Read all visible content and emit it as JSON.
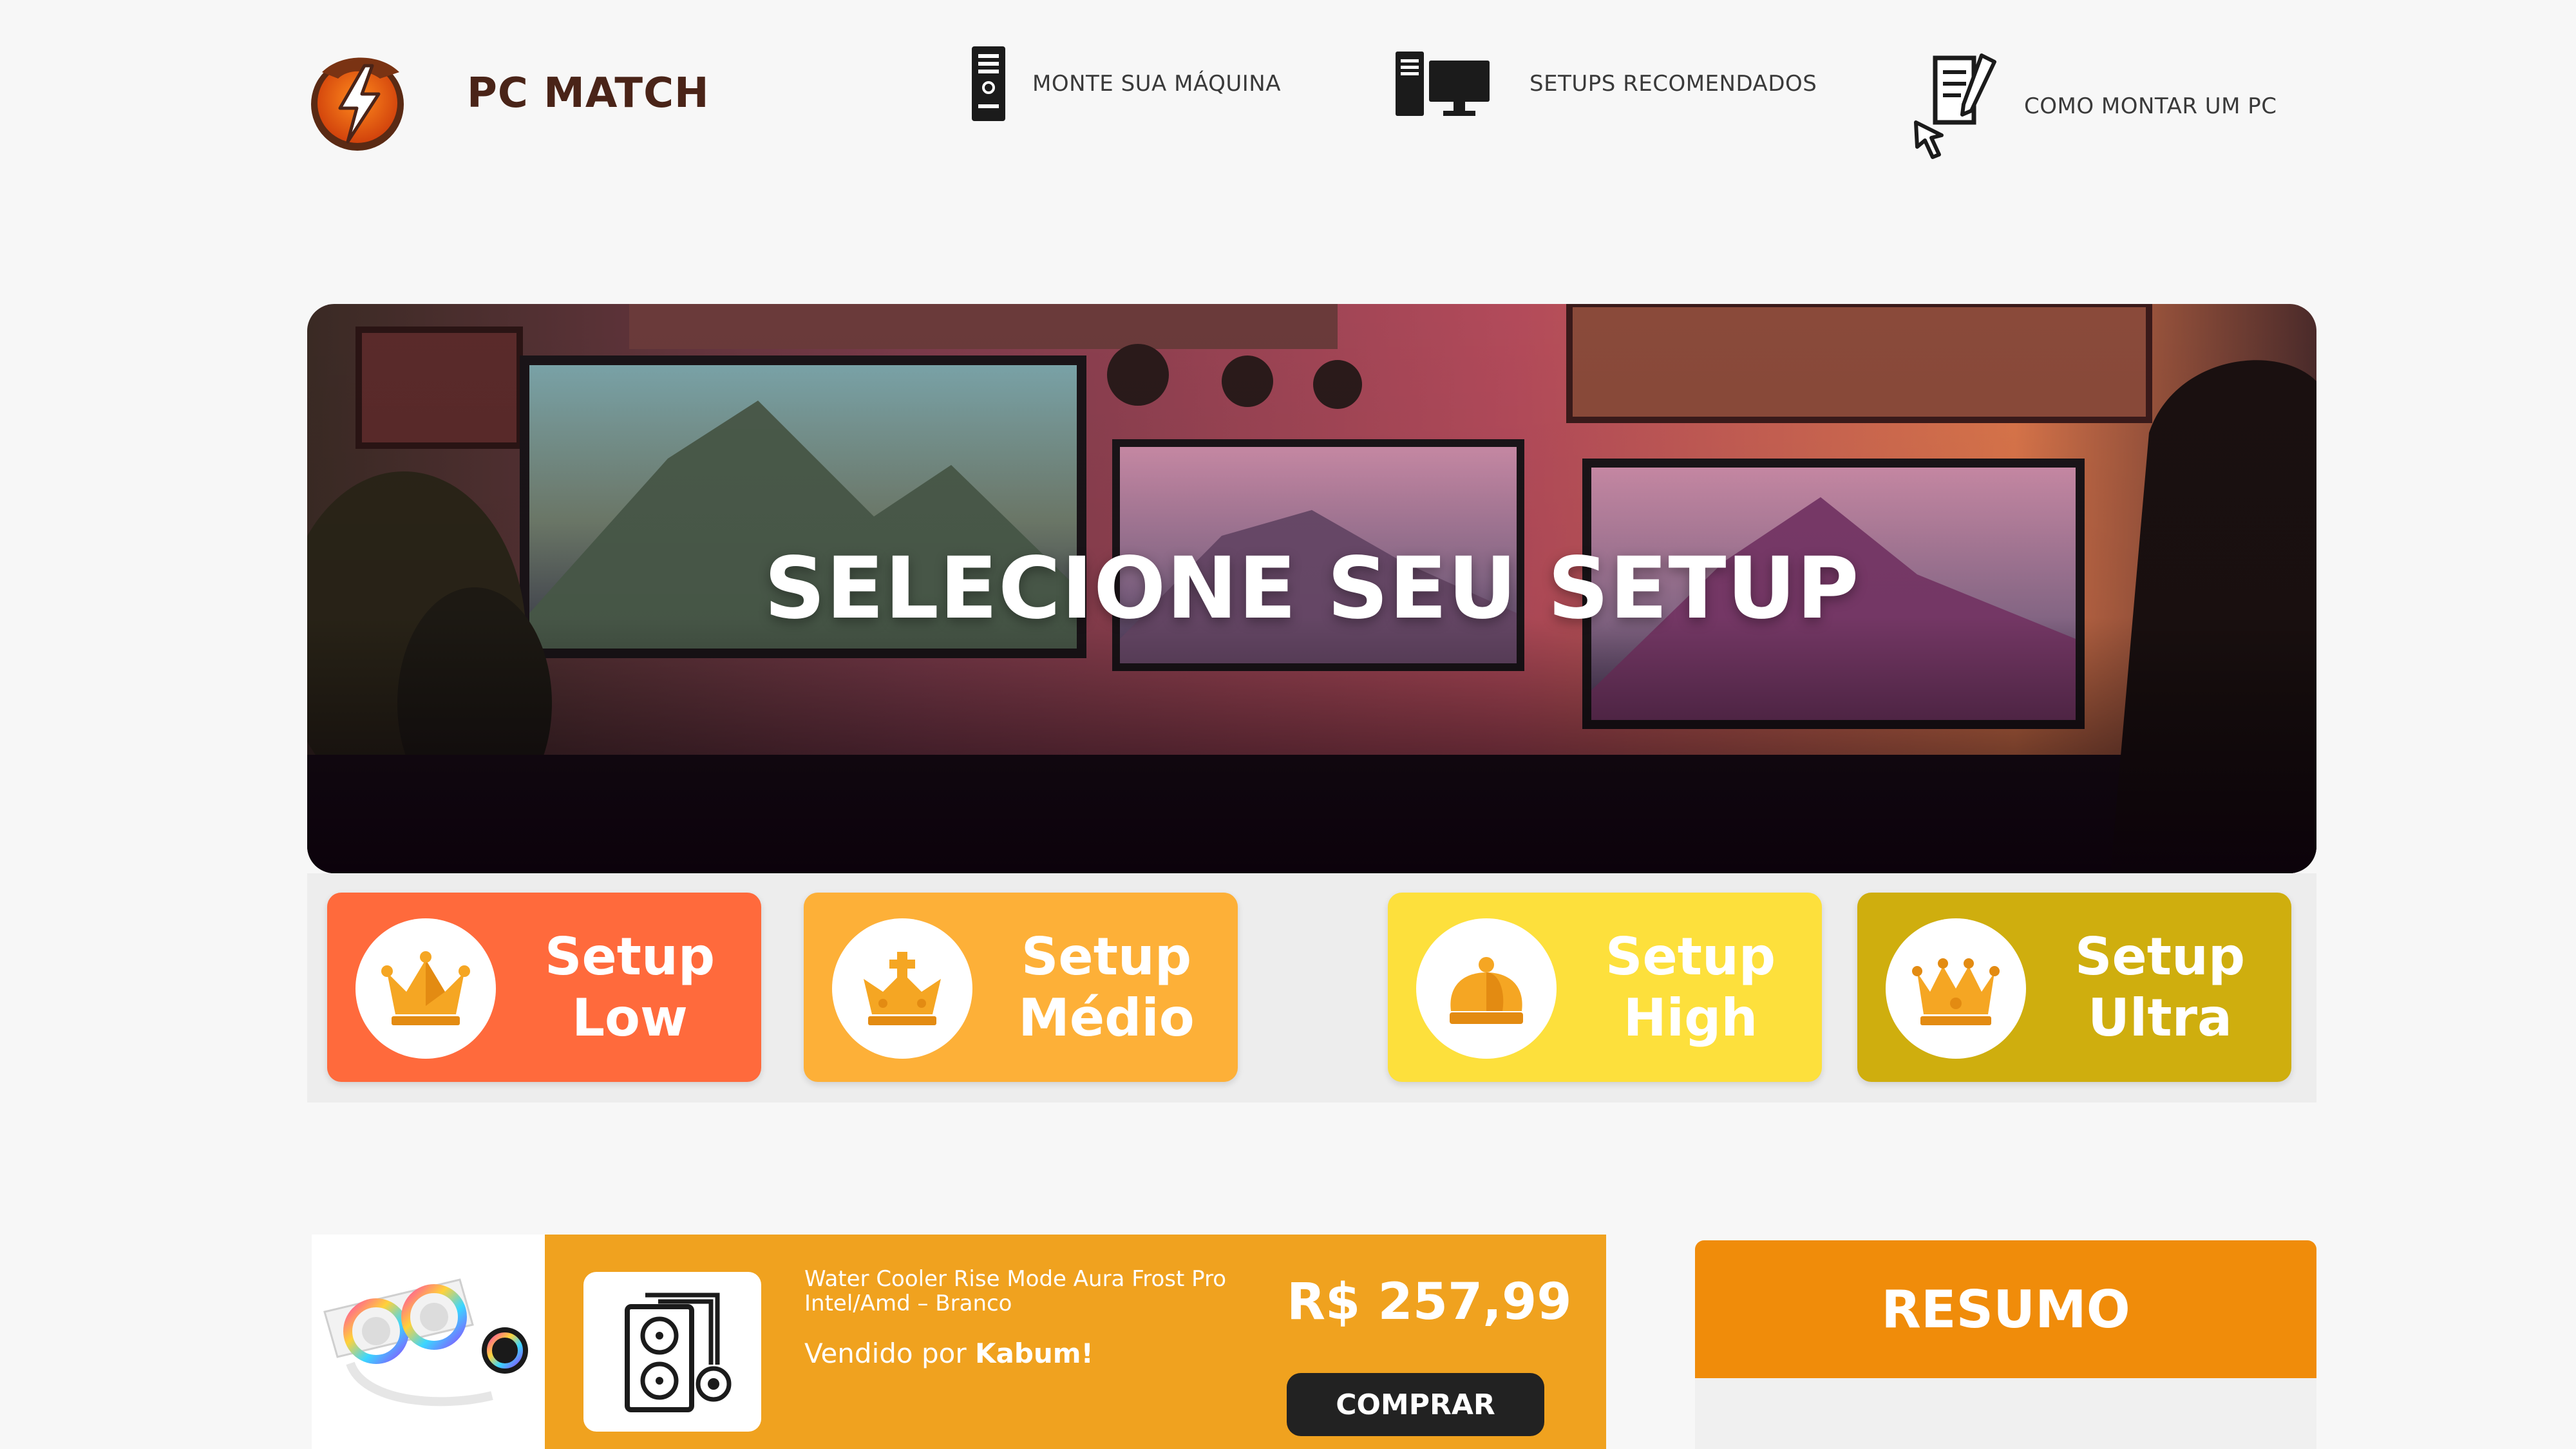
{
  "brand": {
    "name": "PC MATCH"
  },
  "nav": [
    {
      "label": "MONTE SUA MÁQUINA",
      "icon": "pc-tower-icon"
    },
    {
      "label": "SETUPS RECOMENDADOS",
      "icon": "desktop-setup-icon"
    },
    {
      "label": "COMO MONTAR UM PC",
      "icon": "document-pen-icon"
    }
  ],
  "hero": {
    "title": "SELECIONE SEU SETUP"
  },
  "setups": [
    {
      "label_line1": "Setup",
      "label_line2": "Low",
      "color": "#ff6a3c"
    },
    {
      "label_line1": "Setup",
      "label_line2": "Médio",
      "color": "#fdb038"
    },
    {
      "label_line1": "Setup",
      "label_line2": "High",
      "color": "#fde03c"
    },
    {
      "label_line1": "Setup",
      "label_line2": "Ultra",
      "color": "#cfae0e"
    }
  ],
  "product": {
    "name": "Water Cooler Rise Mode Aura Frost Pro Intel/Amd – Branco",
    "seller_prefix": "Vendido por",
    "seller": "Kabum!",
    "price": "R$ 257,99",
    "buy_label": "COMPRAR",
    "category_icon": "water-cooler-icon"
  },
  "summary": {
    "title": "RESUMO"
  },
  "colors": {
    "brand_orange": "#f08c0a",
    "product_bg": "#f0a21f",
    "page_bg": "#f7f7f7"
  }
}
